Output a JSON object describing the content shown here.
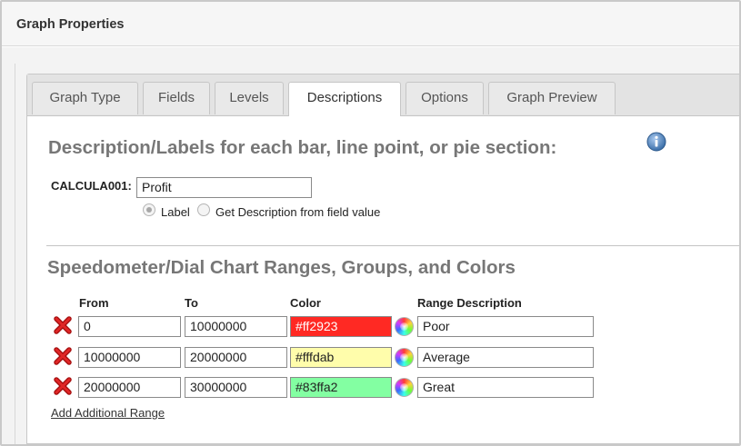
{
  "window": {
    "title": "Graph Properties"
  },
  "tabs": [
    {
      "label": "Graph Type"
    },
    {
      "label": "Fields"
    },
    {
      "label": "Levels"
    },
    {
      "label": "Descriptions",
      "active": true
    },
    {
      "label": "Options"
    },
    {
      "label": "Graph Preview"
    }
  ],
  "descriptions": {
    "heading": "Description/Labels for each bar, line point, or pie section:",
    "info_icon": "info-icon",
    "field_label": "CALCULA001:",
    "field_value": "Profit",
    "radio_options": [
      {
        "label": "Label",
        "checked": true
      },
      {
        "label": "Get Description from field value",
        "checked": false
      }
    ]
  },
  "ranges": {
    "heading": "Speedometer/Dial Chart Ranges, Groups, and Colors",
    "columns": {
      "from": "From",
      "to": "To",
      "color": "Color",
      "description": "Range Description"
    },
    "rows": [
      {
        "from": "0",
        "to": "10000000",
        "color": "#ff2923",
        "description": "Poor"
      },
      {
        "from": "10000000",
        "to": "20000000",
        "color": "#fffdab",
        "description": "Average"
      },
      {
        "from": "20000000",
        "to": "30000000",
        "color": "#83ffa2",
        "description": "Great"
      }
    ],
    "add_link": "Add Additional Range",
    "delete_icon": "delete-x-icon",
    "picker_icon": "color-wheel-icon"
  }
}
